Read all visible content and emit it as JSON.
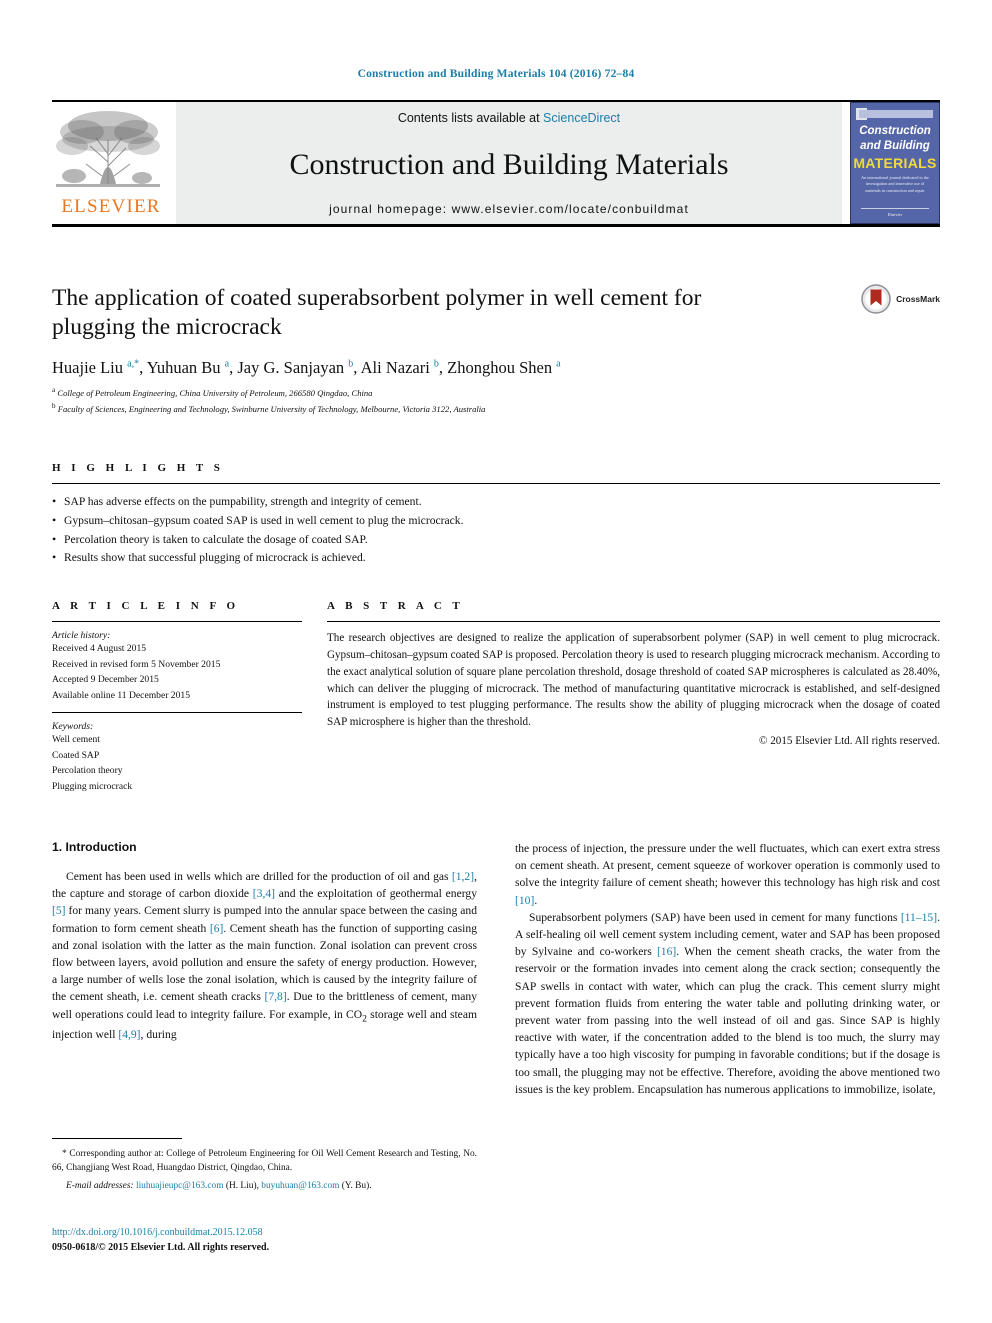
{
  "running_head": "Construction and Building Materials 104 (2016) 72–84",
  "masthead": {
    "contents_prefix": "Contents lists available at ",
    "sciencedirect": "ScienceDirect",
    "journal_name": "Construction and Building Materials",
    "homepage": "journal homepage: www.elsevier.com/locate/conbuildmat",
    "publisher_logo_text": "ELSEVIER",
    "cover": {
      "line1": "Construction",
      "line2": "and Building",
      "line3": "MATERIALS",
      "blurb": "An international journal dedicated to the investigation and innovative use of materials in construction and repair",
      "footer": "Elsevier"
    }
  },
  "article": {
    "title": "The application of coated superabsorbent polymer in well cement for plugging the microcrack",
    "crossmark_label": "CrossMark",
    "authors_html": "Huajie Liu <sup>a,*</sup>, Yuhuan Bu <sup>a</sup>, Jay G. Sanjayan <sup>b</sup>, Ali Nazari <sup>b</sup>, Zhonghou Shen <sup>a</sup>",
    "affiliations": [
      "a College of Petroleum Engineering, China University of Petroleum, 266580 Qingdao, China",
      "b Faculty of Sciences, Engineering and Technology, Swinburne University of Technology, Melbourne, Victoria 3122, Australia"
    ]
  },
  "highlights": {
    "heading": "H I G H L I G H T S",
    "items": [
      "SAP has adverse effects on the pumpability, strength and integrity of cement.",
      "Gypsum–chitosan–gypsum coated SAP is used in well cement to plug the microcrack.",
      "Percolation theory is taken to calculate the dosage of coated SAP.",
      "Results show that successful plugging of microcrack is achieved."
    ]
  },
  "article_info": {
    "heading": "A R T I C L E   I N F O",
    "history_label": "Article history:",
    "history": [
      "Received 4 August 2015",
      "Received in revised form 5 November 2015",
      "Accepted 9 December 2015",
      "Available online 11 December 2015"
    ],
    "keywords_label": "Keywords:",
    "keywords": [
      "Well cement",
      "Coated SAP",
      "Percolation theory",
      "Plugging microcrack"
    ]
  },
  "abstract": {
    "heading": "A B S T R A C T",
    "text": "The research objectives are designed to realize the application of superabsorbent polymer (SAP) in well cement to plug microcrack. Gypsum–chitosan–gypsum coated SAP is proposed. Percolation theory is used to research plugging microcrack mechanism. According to the exact analytical solution of square plane percolation threshold, dosage threshold of coated SAP microspheres is calculated as 28.40%, which can deliver the plugging of microcrack. The method of manufacturing quantitative microcrack is established, and self-designed instrument is employed to test plugging performance. The results show the ability of plugging microcrack when the dosage of coated SAP microsphere is higher than the threshold.",
    "copyright": "© 2015 Elsevier Ltd. All rights reserved."
  },
  "body": {
    "section_heading": "1. Introduction",
    "left_paragraph_1": "Cement has been used in wells which are drilled for the production of oil and gas [1,2], the capture and storage of carbon dioxide [3,4] and the exploitation of geothermal energy [5] for many years. Cement slurry is pumped into the annular space between the casing and formation to form cement sheath [6]. Cement sheath has the function of supporting casing and zonal isolation with the latter as the main function. Zonal isolation can prevent cross flow between layers, avoid pollution and ensure the safety of energy production. However, a large number of wells lose the zonal isolation, which is caused by the integrity failure of the cement sheath, i.e. cement sheath cracks [7,8]. Due to the brittleness of cement, many well operations could lead to integrity failure. For example, in CO2 storage well and steam injection well [4,9], during",
    "right_paragraph_1": "the process of injection, the pressure under the well fluctuates, which can exert extra stress on cement sheath. At present, cement squeeze of workover operation is commonly used to solve the integrity failure of cement sheath; however this technology has high risk and cost [10].",
    "right_paragraph_2": "Superabsorbent polymers (SAP) have been used in cement for many functions [11–15]. A self-healing oil well cement system including cement, water and SAP has been proposed by Sylvaine and co-workers [16]. When the cement sheath cracks, the water from the reservoir or the formation invades into cement along the crack section; consequently the SAP swells in contact with water, which can plug the crack. This cement slurry might prevent formation fluids from entering the water table and polluting drinking water, or prevent water from passing into the well instead of oil and gas. Since SAP is highly reactive with water, if the concentration added to the blend is too much, the slurry may typically have a too high viscosity for pumping in favorable conditions; but if the dosage is too small, the plugging may not be effective. Therefore, avoiding the above mentioned two issues is the key problem. Encapsulation has numerous applications to immobilize, isolate,"
  },
  "footnotes": {
    "corresponding": "Corresponding author at: College of Petroleum Engineering for Oil Well Cement Research and Testing, No. 66, Changjiang West Road, Huangdao District, Qingdao, China.",
    "email_label": "E-mail addresses:",
    "email1": "liuhuajieupc@163.com",
    "email1_who": "(H. Liu),",
    "email2": "buyuhuan@163.com",
    "email2_who": "(Y. Bu)."
  },
  "doi": {
    "url": "http://dx.doi.org/10.1016/j.conbuildmat.2015.12.058",
    "issn": "0950-0618/© 2015 Elsevier Ltd. All rights reserved."
  },
  "colors": {
    "link": "#1a7fa8",
    "elsevier_orange": "#E87722",
    "band_gray": "#eceded",
    "cover_blue": "#5566a8",
    "cover_yellow": "#f2d93c"
  }
}
